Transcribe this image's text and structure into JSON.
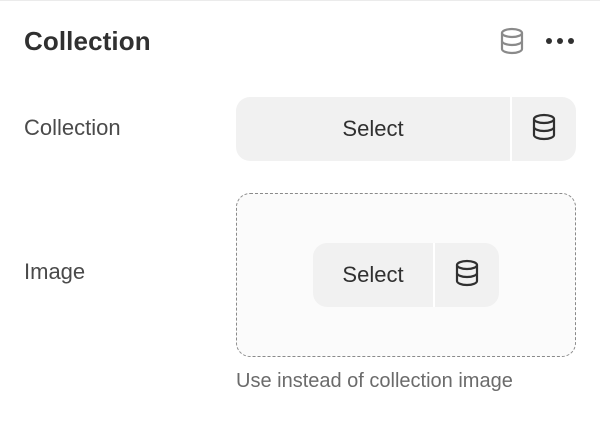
{
  "header": {
    "title": "Collection",
    "icons": [
      "database-icon",
      "more-horizontal-icon"
    ]
  },
  "collection_setting": {
    "label": "Collection",
    "select_label": "Select",
    "icon": "database-icon"
  },
  "image_setting": {
    "label": "Image",
    "select_label": "Select",
    "icon": "database-icon",
    "helper_text": "Use instead of collection image"
  },
  "colors": {
    "text": "#303030",
    "button_bg": "#f1f1f1",
    "helper_text": "#6b6b6b",
    "dashed_border": "#8a8a8a"
  }
}
